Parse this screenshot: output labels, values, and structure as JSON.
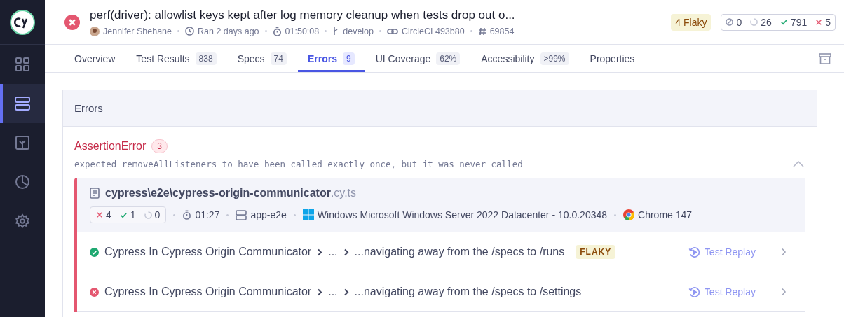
{
  "sidebar": {
    "items": [
      {
        "kind": "grid",
        "selected": false
      },
      {
        "kind": "runs",
        "selected": true
      },
      {
        "kind": "branch",
        "selected": false
      },
      {
        "kind": "pie",
        "selected": false
      },
      {
        "kind": "gear",
        "selected": false
      }
    ]
  },
  "run": {
    "kind": "failed",
    "title": "perf(driver): allowlist keys kept after log memory cleanup when tests drop out o...",
    "author": "Jennifer Shehane",
    "ran": "Ran 2 days ago",
    "duration": "01:50:08",
    "branch": "develop",
    "ci": "CircleCI 493b80",
    "number": "69854",
    "flaky": "4 Flaky",
    "counts": [
      {
        "kind": "skipped",
        "value": "0"
      },
      {
        "kind": "pending",
        "value": "26"
      },
      {
        "kind": "passed",
        "value": "791"
      },
      {
        "kind": "failed",
        "value": "5"
      }
    ]
  },
  "tabs": [
    {
      "label": "Overview",
      "selected": false
    },
    {
      "label": "Test Results",
      "count": "838",
      "selected": false
    },
    {
      "label": "Specs",
      "count": "74",
      "selected": false
    },
    {
      "label": "Errors",
      "count": "9",
      "selected": true
    },
    {
      "label": "UI Coverage",
      "count": "62%",
      "selected": false
    },
    {
      "label": "Accessibility",
      "count": ">99%",
      "selected": false
    },
    {
      "label": "Properties",
      "selected": false
    }
  ],
  "panel": {
    "title": "Errors",
    "error": {
      "name": "AssertionError",
      "count": "3",
      "message": "expected removeAllListeners to have been called exactly once, but it was never called",
      "expanded": true,
      "spec": {
        "path": "cypress\\e2e\\cypress-origin-communicator",
        "ext": ".cy.ts",
        "failed": "4",
        "passed": "1",
        "pending": "0",
        "duration": "01:27",
        "group": "app-e2e",
        "os": "Windows Microsoft Windows Server 2022 Datacenter - 10.0.20348",
        "browser": "Chrome 147",
        "tests": [
          {
            "kind": "passed",
            "suite": "Cypress In Cypress Origin Communicator",
            "middle": "...",
            "title": "...navigating away from the /specs to /runs",
            "flaky": "FLAKY",
            "replay": "Test Replay"
          },
          {
            "kind": "failed",
            "suite": "Cypress In Cypress Origin Communicator",
            "middle": "...",
            "title": "...navigating away from the /specs to /settings",
            "replay": "Test Replay"
          }
        ]
      }
    }
  }
}
